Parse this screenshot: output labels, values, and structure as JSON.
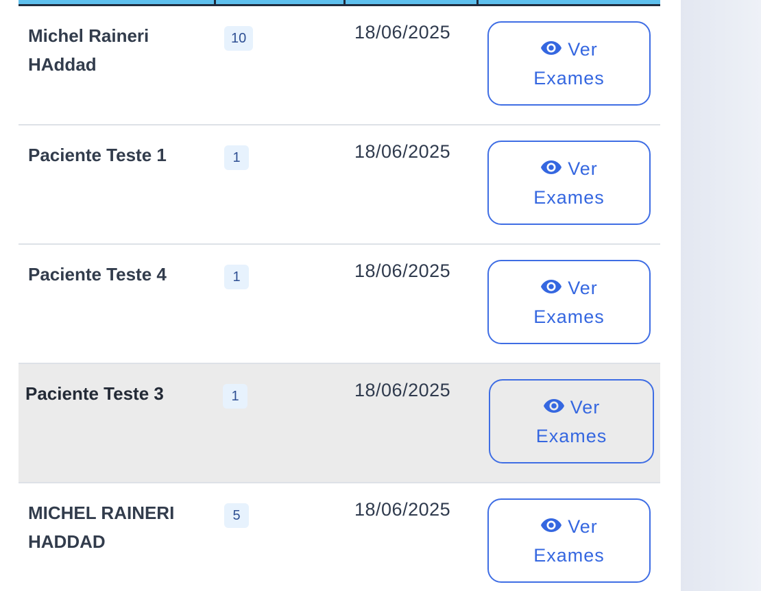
{
  "table": {
    "rows": [
      {
        "name": "Michel Raineri HAddad",
        "count": "10",
        "date": "18/06/2025",
        "btn_line1": "Ver",
        "btn_line2": "Exames"
      },
      {
        "name": "Paciente Teste 1",
        "count": "1",
        "date": "18/06/2025",
        "btn_line1": "Ver",
        "btn_line2": "Exames"
      },
      {
        "name": "Paciente Teste 4",
        "count": "1",
        "date": "18/06/2025",
        "btn_line1": "Ver",
        "btn_line2": "Exames"
      },
      {
        "name": "Paciente Teste 3",
        "count": "1",
        "date": "18/06/2025",
        "btn_line1": "Ver",
        "btn_line2": "Exames"
      },
      {
        "name": "MICHEL RAINERI HADDAD",
        "count": "5",
        "date": "18/06/2025",
        "btn_line1": "Ver",
        "btn_line2": "Exames"
      }
    ]
  },
  "button_icon": "eye-icon",
  "colors": {
    "accent": "#3567e0",
    "header_bar": "#5ec0ee",
    "badge_bg": "#e7f2fd",
    "hover_row": "#ebebeb",
    "side_panel": "#e6eaf3"
  }
}
